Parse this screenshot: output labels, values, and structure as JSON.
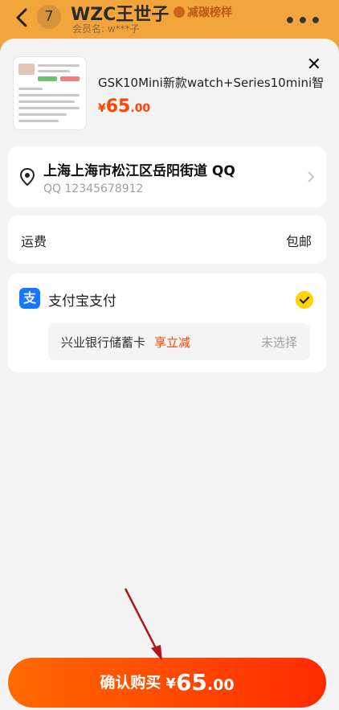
{
  "header": {
    "unread_count": "7",
    "title": "WZC王世子",
    "tag": "减碳榜样",
    "subtitle": "会员名: w***子"
  },
  "product": {
    "title": "GSK10Mini新款watch+Series10mini智",
    "price_currency": "¥",
    "price_integer": "65",
    "price_decimal": ".00"
  },
  "address": {
    "line": "上海上海市松江区岳阳街道 QQ",
    "contact": "QQ 12345678912"
  },
  "shipping": {
    "label": "运费",
    "value": "包邮"
  },
  "payment": {
    "method": "支付宝支付",
    "icon_text": "支",
    "bank": "兴业银行储蓄卡",
    "bank_promo": "享立减",
    "bank_status": "未选择"
  },
  "confirm": {
    "label": "确认购买",
    "currency": "¥",
    "integer": "65",
    "decimal": ".00"
  },
  "colors": {
    "accent": "#ff4400",
    "alipay": "#1677ff",
    "check": "#ffd400",
    "annotation_arrow": "#b01818"
  }
}
